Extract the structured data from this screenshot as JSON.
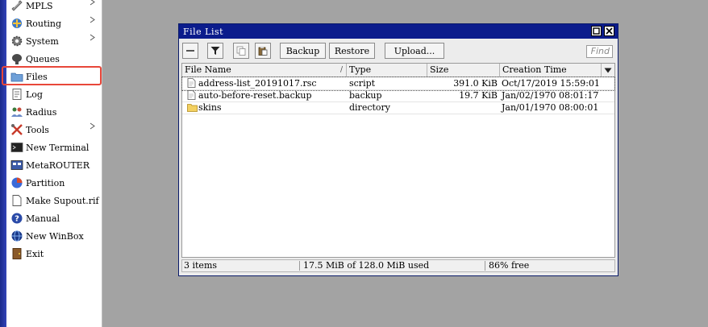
{
  "sidebar": {
    "items": [
      {
        "label": "MPLS",
        "icon": "mpls-icon",
        "submenu": true
      },
      {
        "label": "Routing",
        "icon": "routing-icon",
        "submenu": true
      },
      {
        "label": "System",
        "icon": "gear-icon",
        "submenu": true
      },
      {
        "label": "Queues",
        "icon": "queues-icon",
        "submenu": false
      },
      {
        "label": "Files",
        "icon": "folder-icon",
        "submenu": false
      },
      {
        "label": "Log",
        "icon": "log-icon",
        "submenu": false
      },
      {
        "label": "Radius",
        "icon": "radius-icon",
        "submenu": false
      },
      {
        "label": "Tools",
        "icon": "tools-icon",
        "submenu": true
      },
      {
        "label": "New Terminal",
        "icon": "terminal-icon",
        "submenu": false
      },
      {
        "label": "MetaROUTER",
        "icon": "metarouter-icon",
        "submenu": false
      },
      {
        "label": "Partition",
        "icon": "partition-icon",
        "submenu": false
      },
      {
        "label": "Make Supout.rif",
        "icon": "document-icon",
        "submenu": false
      },
      {
        "label": "Manual",
        "icon": "help-icon",
        "submenu": false
      },
      {
        "label": "New WinBox",
        "icon": "globe-icon",
        "submenu": false
      },
      {
        "label": "Exit",
        "icon": "exit-icon",
        "submenu": false
      }
    ],
    "submenu_glyph": "▶"
  },
  "window": {
    "title": "File List",
    "restore_glyph": "□",
    "close_glyph": "×",
    "toolbar": {
      "backup_label": "Backup",
      "restore_label": "Restore",
      "upload_label": "Upload...",
      "find_placeholder": "Find"
    },
    "table": {
      "columns": [
        "File Name",
        "Type",
        "Size",
        "Creation Time"
      ],
      "sort_glyph": "/",
      "rows": [
        {
          "name": "address-list_20191017.rsc",
          "type": "script",
          "size": "391.0 KiB",
          "time": "Oct/17/2019 15:59:01",
          "icon": "file-icon"
        },
        {
          "name": "auto-before-reset.backup",
          "type": "backup",
          "size": "19.7 KiB",
          "time": "Jan/02/1970 08:01:17",
          "icon": "file-icon"
        },
        {
          "name": "skins",
          "type": "directory",
          "size": "",
          "time": "Jan/01/1970 08:00:01",
          "icon": "folder-icon"
        }
      ]
    },
    "status": {
      "items": "3 items",
      "used": "17.5 MiB of 128.0 MiB used",
      "free": "86% free"
    }
  },
  "colors": {
    "titlebar": "#0b1c8c",
    "highlight": "#e8473a",
    "workspace": "#a3a3a3"
  }
}
